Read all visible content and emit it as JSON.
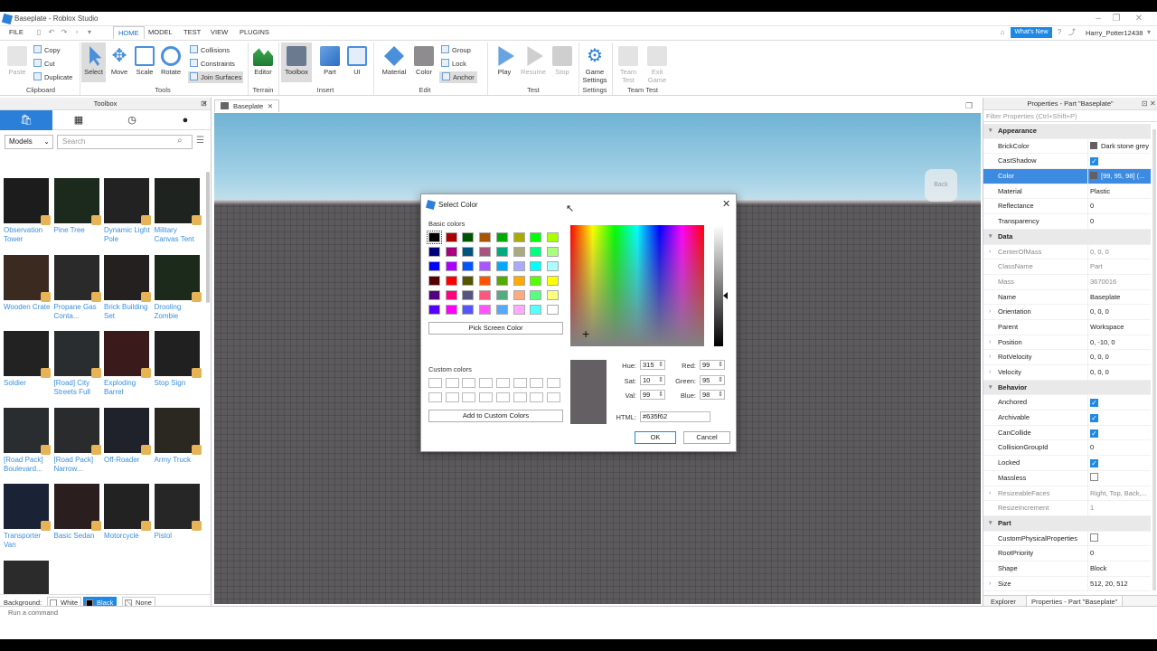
{
  "window": {
    "title": "Baseplate - Roblox Studio",
    "user": "Harry_Potter12438",
    "whats_new": "What's New"
  },
  "ribbon": {
    "tabs": [
      "FILE",
      "HOME",
      "MODEL",
      "TEST",
      "VIEW",
      "PLUGINS"
    ],
    "clipboard": {
      "paste": "Paste",
      "copy": "Copy",
      "cut": "Cut",
      "duplicate": "Duplicate",
      "label": "Clipboard"
    },
    "tools": {
      "select": "Select",
      "move": "Move",
      "scale": "Scale",
      "rotate": "Rotate",
      "collisions": "Collisions",
      "constraints": "Constraints",
      "join": "Join Surfaces",
      "label": "Tools"
    },
    "terrain": {
      "editor": "Editor",
      "label": "Terrain"
    },
    "insert": {
      "toolbox": "Toolbox",
      "part": "Part",
      "ui": "UI",
      "label": "Insert"
    },
    "edit": {
      "material": "Material",
      "color": "Color",
      "group": "Group",
      "lock": "Lock",
      "anchor": "Anchor",
      "label": "Edit"
    },
    "test": {
      "play": "Play",
      "resume": "Resume",
      "stop": "Stop",
      "label": "Test"
    },
    "settings": {
      "game": "Game Settings",
      "label": "Settings"
    },
    "teamtest": {
      "team": "Team Test",
      "exit": "Exit Game",
      "label": "Team Test"
    }
  },
  "toolbox": {
    "title": "Toolbox",
    "category": "Models",
    "search_placeholder": "Search",
    "items": [
      "Observation Tower",
      "Pine Tree",
      "Dynamic Light Pole",
      "Military Canvas Tent",
      "Wooden Crate",
      "Propane Gas Conta...",
      "Brick Building Set",
      "Drooling Zombie",
      "Soldier",
      "[Road] City Streets Full",
      "Exploding Barrel",
      "Stop Sign",
      "[Road Pack] Boulevard...",
      "[Road Pack] Narrow...",
      "Off-Roader",
      "Army Truck",
      "Transporter Van",
      "Basic Sedan",
      "Motorcycle",
      "Pistol",
      ""
    ],
    "background_label": "Background:",
    "backgrounds": [
      "White",
      "Black",
      "None"
    ]
  },
  "viewport": {
    "tab": "Baseplate",
    "cube": "Back"
  },
  "command": {
    "placeholder": "Run a command"
  },
  "properties": {
    "title": "Properties - Part \"Baseplate\"",
    "filter": "Filter Properties (Ctrl+Shift+P)",
    "rows": [
      {
        "k": "Appearance",
        "cat": true
      },
      {
        "k": "BrickColor",
        "v": "Dark stone grey",
        "sw": "#635f62"
      },
      {
        "k": "CastShadow",
        "chk": true
      },
      {
        "k": "Color",
        "v": "[99, 95, 98] (...",
        "sw": "#635f62",
        "sel": true
      },
      {
        "k": "Material",
        "v": "Plastic"
      },
      {
        "k": "Reflectance",
        "v": "0"
      },
      {
        "k": "Transparency",
        "v": "0"
      },
      {
        "k": "Data",
        "cat": true
      },
      {
        "k": "CenterOfMass",
        "v": "0, 0, 0",
        "g": true,
        "exp": true
      },
      {
        "k": "ClassName",
        "v": "Part",
        "g": true
      },
      {
        "k": "Mass",
        "v": "3670016",
        "g": true
      },
      {
        "k": "Name",
        "v": "Baseplate"
      },
      {
        "k": "Orientation",
        "v": "0, 0, 0",
        "exp": true
      },
      {
        "k": "Parent",
        "v": "Workspace"
      },
      {
        "k": "Position",
        "v": "0, -10, 0",
        "exp": true
      },
      {
        "k": "RotVelocity",
        "v": "0, 0, 0",
        "exp": true
      },
      {
        "k": "Velocity",
        "v": "0, 0, 0",
        "exp": true
      },
      {
        "k": "Behavior",
        "cat": true
      },
      {
        "k": "Anchored",
        "chk": true
      },
      {
        "k": "Archivable",
        "chk": true
      },
      {
        "k": "CanCollide",
        "chk": true
      },
      {
        "k": "CollisionGroupId",
        "v": "0"
      },
      {
        "k": "Locked",
        "chk": true
      },
      {
        "k": "Massless",
        "chk": false
      },
      {
        "k": "ResizeableFaces",
        "v": "Right, Top, Back,...",
        "g": true,
        "exp": true
      },
      {
        "k": "ResizeIncrement",
        "v": "1",
        "g": true
      },
      {
        "k": "Part",
        "cat": true
      },
      {
        "k": "CustomPhysicalProperties",
        "chk": false
      },
      {
        "k": "RootPriority",
        "v": "0"
      },
      {
        "k": "Shape",
        "v": "Block"
      },
      {
        "k": "Size",
        "v": "512, 20, 512",
        "exp": true
      }
    ],
    "tabs": [
      "Explorer",
      "Properties - Part \"Baseplate\""
    ]
  },
  "dialog": {
    "title": "Select Color",
    "basic_label": "Basic colors",
    "basic": [
      "#000000",
      "#aa0000",
      "#005500",
      "#aa5500",
      "#00aa00",
      "#aaaa00",
      "#00ff00",
      "#aaff00",
      "#00007f",
      "#aa007f",
      "#00557f",
      "#aa557f",
      "#00aa7f",
      "#aaaa7f",
      "#00ff7f",
      "#aaff7f",
      "#0000ff",
      "#aa00ff",
      "#0055ff",
      "#aa55ff",
      "#00aaff",
      "#aaaaff",
      "#00ffff",
      "#aaffff",
      "#550000",
      "#ff0000",
      "#555500",
      "#ff5500",
      "#55aa00",
      "#ffaa00",
      "#55ff00",
      "#ffff00",
      "#55007f",
      "#ff007f",
      "#55557f",
      "#ff557f",
      "#55aa7f",
      "#ffaa7f",
      "#55ff7f",
      "#ffff7f",
      "#5500ff",
      "#ff00ff",
      "#5555ff",
      "#ff55ff",
      "#55aaff",
      "#ffaaff",
      "#55ffff",
      "#ffffff"
    ],
    "pick": "Pick Screen Color",
    "custom_label": "Custom colors",
    "add": "Add to Custom Colors",
    "hue_l": "Hue:",
    "hue": "315",
    "sat_l": "Sat:",
    "sat": "10",
    "val_l": "Val:",
    "val": "99",
    "red_l": "Red:",
    "red": "99",
    "green_l": "Green:",
    "green": "95",
    "blue_l": "Blue:",
    "blue": "98",
    "html_l": "HTML:",
    "html": "#635f62",
    "ok": "OK",
    "cancel": "Cancel",
    "preview_color": "#635f62"
  }
}
